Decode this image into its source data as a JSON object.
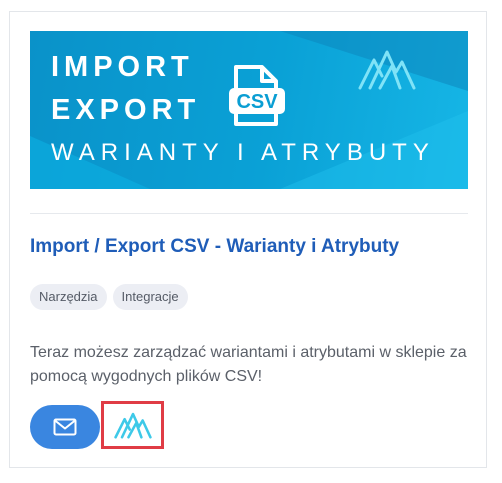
{
  "banner": {
    "line1": "IMPORT",
    "line2": "EXPORT",
    "line3": "WARIANTY I ATRYBUTY",
    "badge": "CSV",
    "logo_icon": "brand-logo-icon",
    "colors": {
      "background": "#0a9ed3",
      "text": "#ffffff"
    }
  },
  "product": {
    "title": "Import / Export CSV - Warianty i Atrybuty",
    "tags": [
      "Narzędzia",
      "Integracje"
    ],
    "description": "Teraz możesz zarządzać wariantami i atrybutami w sklepie za pomocą wygodnych plików CSV!"
  },
  "actions": {
    "mail_icon": "envelope-icon",
    "logo_icon": "brand-logo-icon",
    "accent": "#3a86e0",
    "highlight": "#e03c45"
  }
}
